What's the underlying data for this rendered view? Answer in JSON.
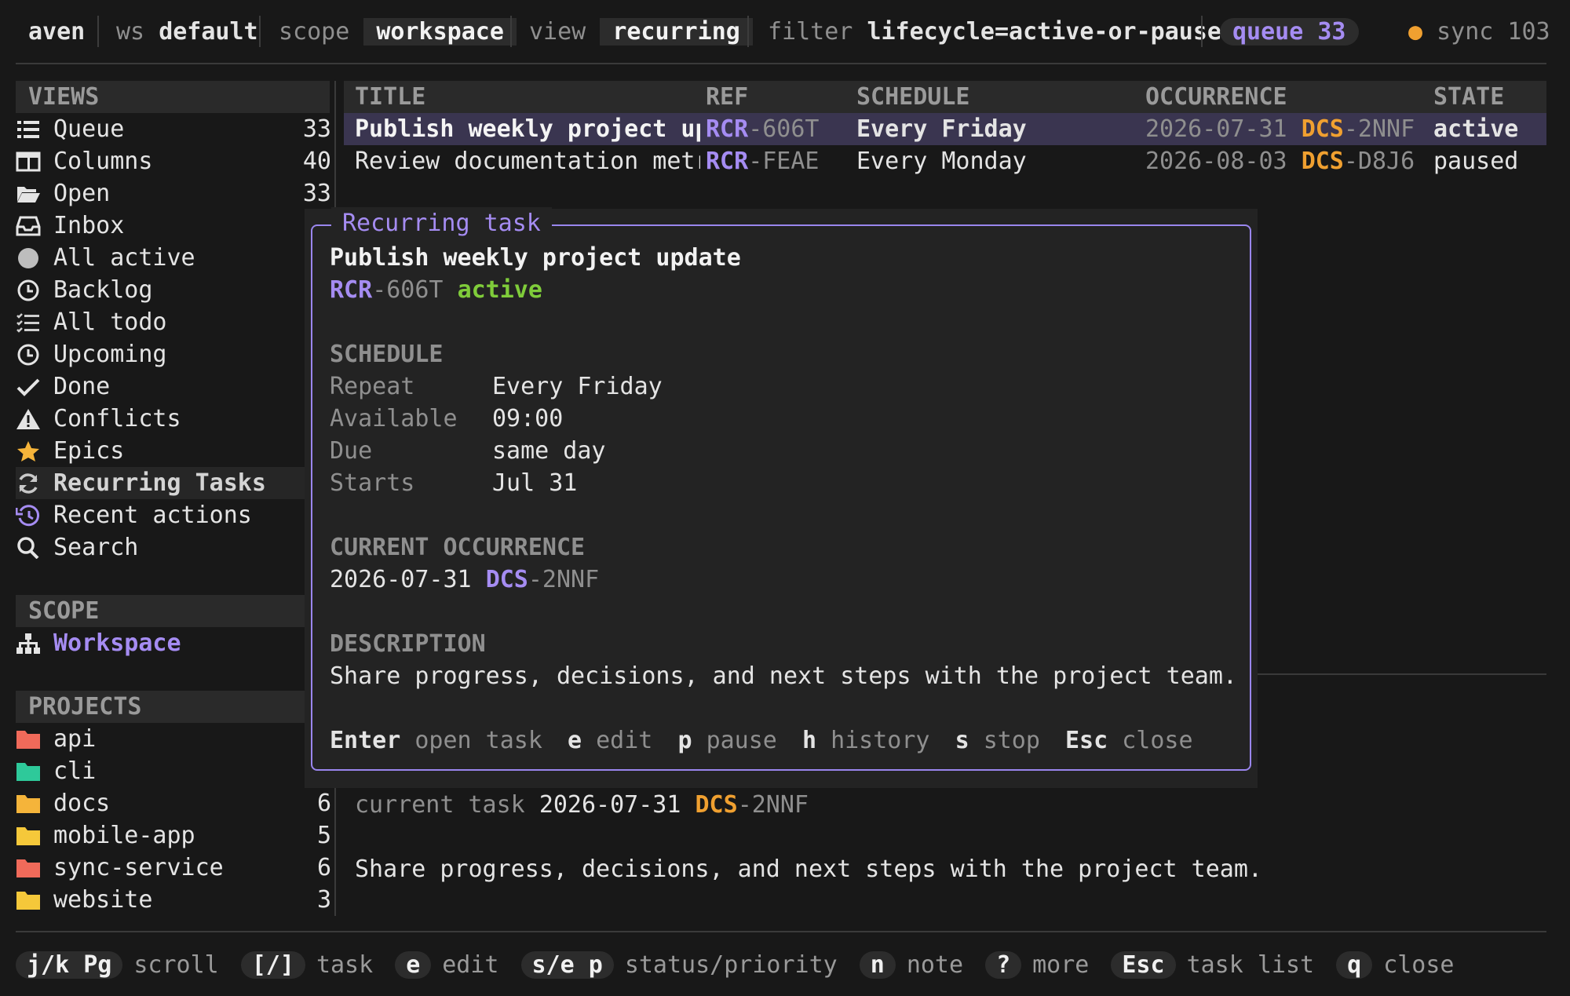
{
  "topbar": {
    "app": "aven",
    "ws_label": "ws",
    "ws_value": "default",
    "scope_label": "scope",
    "scope_value": "workspace",
    "view_label": "view",
    "view_value": "recurring",
    "filter_label": "filter",
    "filter_value": "lifecycle=active-or-paused",
    "queue_label": "queue",
    "queue_count": "33",
    "sync_label": "sync 103",
    "sync_dot_color": "#f0a030"
  },
  "sidebar": {
    "views_header": "VIEWS",
    "views": [
      {
        "icon": "list-icon",
        "label": "Queue",
        "count": "33"
      },
      {
        "icon": "columns-icon",
        "label": "Columns",
        "count": "40"
      },
      {
        "icon": "folder-open-icon",
        "label": "Open",
        "count": "33"
      },
      {
        "icon": "inbox-icon",
        "label": "Inbox",
        "count": ""
      },
      {
        "icon": "circle-icon",
        "label": "All active",
        "count": ""
      },
      {
        "icon": "clock-icon",
        "label": "Backlog",
        "count": ""
      },
      {
        "icon": "checklist-icon",
        "label": "All todo",
        "count": ""
      },
      {
        "icon": "clock-icon",
        "label": "Upcoming",
        "count": ""
      },
      {
        "icon": "check-icon",
        "label": "Done",
        "count": ""
      },
      {
        "icon": "warning-icon",
        "label": "Conflicts",
        "count": ""
      },
      {
        "icon": "star-icon",
        "label": "Epics",
        "count": ""
      },
      {
        "icon": "refresh-icon",
        "label": "Recurring Tasks",
        "count": ""
      },
      {
        "icon": "history-icon",
        "label": "Recent actions",
        "count": ""
      },
      {
        "icon": "search-icon",
        "label": "Search",
        "count": ""
      }
    ],
    "scope_header": "SCOPE",
    "scope_item": "Workspace",
    "projects_header": "PROJECTS",
    "projects": [
      {
        "label": "api",
        "count": "",
        "color": "#f06a5a"
      },
      {
        "label": "cli",
        "count": "",
        "color": "#2ec99a"
      },
      {
        "label": "docs",
        "count": "6",
        "color": "#f5b43a"
      },
      {
        "label": "mobile-app",
        "count": "5",
        "color": "#f5c83a"
      },
      {
        "label": "sync-service",
        "count": "6",
        "color": "#f06a5a"
      },
      {
        "label": "website",
        "count": "3",
        "color": "#f5c83a"
      }
    ]
  },
  "table": {
    "headers": [
      "TITLE",
      "REF",
      "SCHEDULE",
      "OCCURRENCE",
      "STATE"
    ],
    "rows": [
      {
        "title": "Publish weekly project upda",
        "ref_prefix": "RCR",
        "ref_id": "-606T",
        "schedule": "Every Friday",
        "occ_date": "2026-07-31",
        "occ_prefix": "DCS",
        "occ_id": "-2NNF",
        "state": "active"
      },
      {
        "title": "Review documentation metric",
        "ref_prefix": "RCR",
        "ref_id": "-FEAE",
        "schedule": "Every Monday",
        "occ_date": "2026-08-03",
        "occ_prefix": "DCS",
        "occ_id": "-D8J6",
        "state": "paused"
      }
    ]
  },
  "detail": {
    "current_task_label": "current task",
    "occ_date": "2026-07-31",
    "occ_prefix": "DCS",
    "occ_id": "-2NNF",
    "description": "Share progress, decisions, and next steps with the project team."
  },
  "popup": {
    "title": "Recurring task",
    "task_title": "Publish weekly project update",
    "ref_prefix": "RCR",
    "ref_id": "-606T",
    "state": "active",
    "schedule_header": "SCHEDULE",
    "schedule": [
      {
        "key": "Repeat",
        "value": "Every Friday"
      },
      {
        "key": "Available",
        "value": "09:00"
      },
      {
        "key": "Due",
        "value": "same day"
      },
      {
        "key": "Starts",
        "value": "Jul 31"
      }
    ],
    "occurrence_header": "CURRENT OCCURRENCE",
    "occ_date": "2026-07-31",
    "occ_prefix": "DCS",
    "occ_id": "-2NNF",
    "description_header": "DESCRIPTION",
    "description": "Share progress, decisions, and next steps with the project team.",
    "actions": [
      {
        "key": "Enter",
        "label": "open task"
      },
      {
        "key": "e",
        "label": "edit"
      },
      {
        "key": "p",
        "label": "pause"
      },
      {
        "key": "h",
        "label": "history"
      },
      {
        "key": "s",
        "label": "stop"
      },
      {
        "key": "Esc",
        "label": "close"
      }
    ]
  },
  "bottombar": [
    {
      "key": "j/k Pg",
      "label": "scroll"
    },
    {
      "key": "[/]",
      "label": "task"
    },
    {
      "key": "e",
      "label": "edit"
    },
    {
      "key": "s/e p",
      "label": "status/priority"
    },
    {
      "key": "n",
      "label": "note"
    },
    {
      "key": "?",
      "label": "more"
    },
    {
      "key": "Esc",
      "label": "task list"
    },
    {
      "key": "q",
      "label": "close"
    }
  ]
}
